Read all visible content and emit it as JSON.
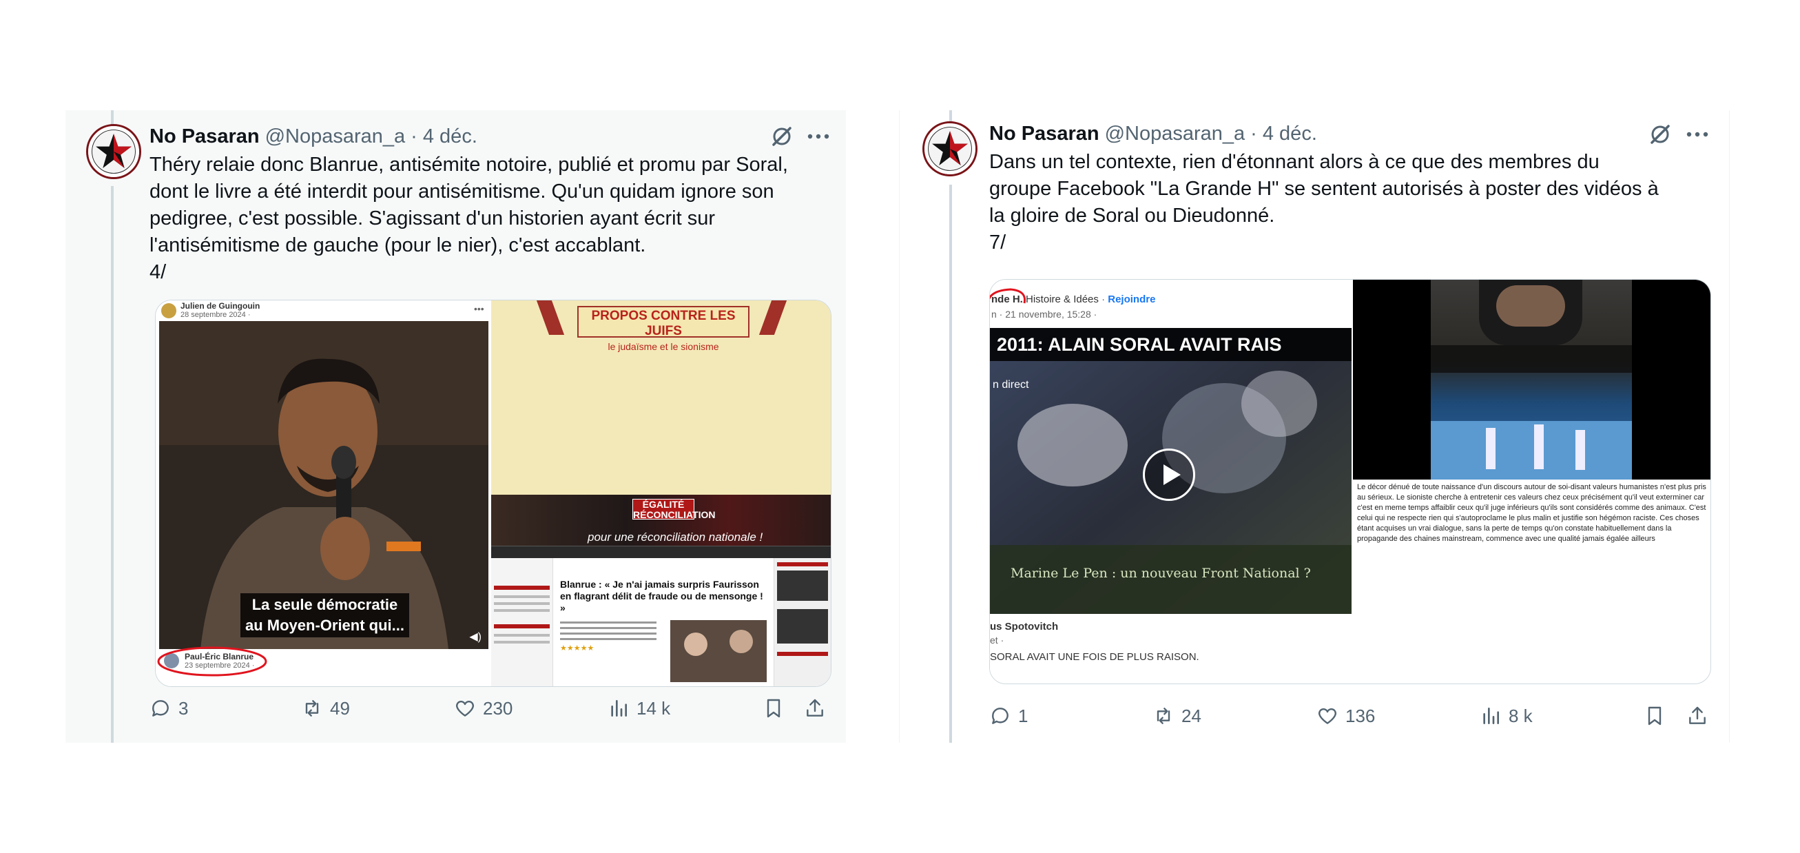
{
  "tweets": [
    {
      "author": {
        "name": "No Pasaran",
        "handle": "@Nopasaran_a",
        "date": "· 4 déc."
      },
      "text": [
        "Théry relaie donc Blanrue, antisémite notoire, publié et promu par Soral,",
        "dont le livre a été interdit pour antisémitisme. Qu'un quidam ignore son",
        "pedigree, c'est possible. S'agissant d'un historien ayant écrit sur",
        "l'antisémitisme de gauche (pour le nier), c'est accablant.",
        "4/"
      ],
      "media": {
        "fb_poster": "Julien de Guingouin",
        "fb_date": "28 septembre 2024 · ",
        "video_caption": "La seule démocratie au Moyen-Orient qui...",
        "tagged_name": "Paul-Éric Blanrue",
        "tagged_date": "23 septembre 2024 · ",
        "book_title": "PROPOS CONTRE LES JUIFS",
        "book_subtitle": "le judaïsme et le sionisme",
        "site_logo": "ÉGALITÉ RÉCONCILIATION",
        "site_slogan": "pour une réconciliation nationale !",
        "article_title": "Blanrue : « Je n'ai jamais surpris Faurisson en flagrant délit de fraude ou de mensonge ! »"
      },
      "stats": {
        "replies": "3",
        "reposts": "49",
        "likes": "230",
        "views": "14 k"
      }
    },
    {
      "author": {
        "name": "No Pasaran",
        "handle": "@Nopasaran_a",
        "date": "· 4 déc."
      },
      "text": [
        "Dans un tel contexte, rien d'étonnant alors à ce que des membres du",
        "groupe Facebook \"La Grande H\" se sentent autorisés à poster des vidéos à",
        "la gloire de Soral ou Dieudonné.",
        "7/"
      ],
      "media": {
        "group_name": "nde H.",
        "group_subname": "Histoire & Idées",
        "join_label": "Rejoindre",
        "post_meta": "n · 21 novembre, 15:28 · ",
        "video_title": "2011: ALAIN SORAL AVAIT RAIS",
        "video_live": "n direct",
        "video_subtitle": "Marine Le Pen : un nouveau Front National ?",
        "poster_name": "us Spotovitch",
        "poster_meta": "et · ",
        "post_text": "SORAL AVAIT UNE FOIS DE PLUS RAISON.",
        "article_text": "Le décor dénué de toute naissance d'un discours autour de soi-disant valeurs humanistes n'est plus pris au sérieux. Le sioniste cherche à entretenir ces valeurs chez ceux précisément qu'il veut exterminer car c'est en meme temps affaiblir ceux qu'il juge inférieurs qu'ils sont considérés comme des animaux. C'est celui qui ne respecte rien qui s'autoproclame le plus malin et justifie son hégémon raciste. Ces choses étant acquises un vrai dialogue, sans la perte de temps qu'on constate habituellement dans la propagande des chaines mainstream, commence avec une qualité jamais égalée ailleurs"
      },
      "stats": {
        "replies": "1",
        "reposts": "24",
        "likes": "136",
        "views": "8 k"
      }
    }
  ],
  "colors": {
    "text": "#0f1419",
    "secondary": "#536471",
    "thread_line": "#cfd9de",
    "annotation_circle": "#e0141e"
  }
}
